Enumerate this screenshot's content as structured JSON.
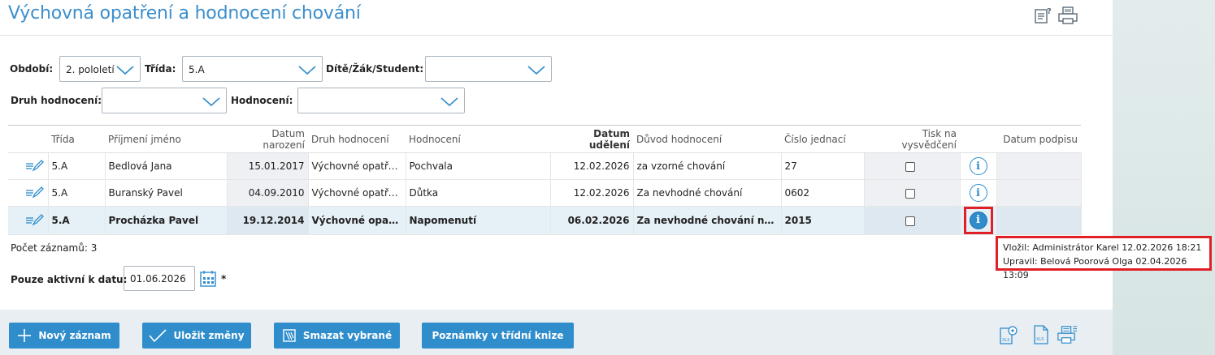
{
  "page": {
    "title": "Výchovná opatření a hodnocení chování",
    "icons": [
      "help-icon",
      "print-icon"
    ]
  },
  "filters": {
    "obdobi_label": "Období:",
    "obdobi_value": "2. pololetí",
    "trida_label": "Třída:",
    "trida_value": "5.A",
    "dite_label": "Dítě/Žák/Student:",
    "dite_value": "",
    "druh_label": "Druh hodnocení:",
    "druh_value": "",
    "hodnoceni_label": "Hodnocení:",
    "hodnoceni_value": ""
  },
  "table": {
    "columns": [
      "Třída",
      "Příjmení jméno",
      "Datum narození",
      "Druh hodnocení",
      "Hodnocení",
      "Datum udělení",
      "Důvod hodnocení",
      "Číslo jednací",
      "Tisk na vysvědčení",
      "Datum podpisu"
    ],
    "rows": [
      {
        "trida": "5.A",
        "jmeno": "Bedlová Jana",
        "narozeni": "15.01.2017",
        "druh": "Výchovné opatření",
        "hodnoceni": "Pochvala",
        "udeleni": "12.02.2026",
        "duvod": "za vzorné chování",
        "cislo": "27",
        "tisk": false,
        "podpis": ""
      },
      {
        "trida": "5.A",
        "jmeno": "Buranský Pavel",
        "narozeni": "04.09.2010",
        "druh": "Výchovné opatření",
        "hodnoceni": "Důtka",
        "udeleni": "12.02.2026",
        "duvod": "Za nevhodné chování",
        "cislo": "0602",
        "tisk": false,
        "podpis": ""
      },
      {
        "trida": "5.A",
        "jmeno": "Procházka Pavel",
        "narozeni": "19.12.2014",
        "druh": "Výchovné opatření",
        "hodnoceni": "Napomenutí",
        "udeleni": "06.02.2026",
        "duvod": "Za nevhodné chování na výl...",
        "cislo": "2015",
        "tisk": false,
        "podpis": ""
      }
    ]
  },
  "footer": {
    "count_text": "Počet záznamů: 3",
    "active_label": "Pouze aktivní k datu:",
    "active_date": "01.06.2026",
    "required_mark": "*"
  },
  "tooltip": {
    "line1": "Vložil: Administrátor Karel 12.02.2026 18:21",
    "line2": "Upravil: Belová Poorová Olga 02.04.2026 13:09"
  },
  "buttons": {
    "new": "Nový záznam",
    "save": "Uložit změny",
    "delete": "Smazat vybrané",
    "notes": "Poznámky v třídní knize"
  },
  "colors": {
    "accent": "#2f8dcc",
    "highlight": "#e01f26"
  }
}
